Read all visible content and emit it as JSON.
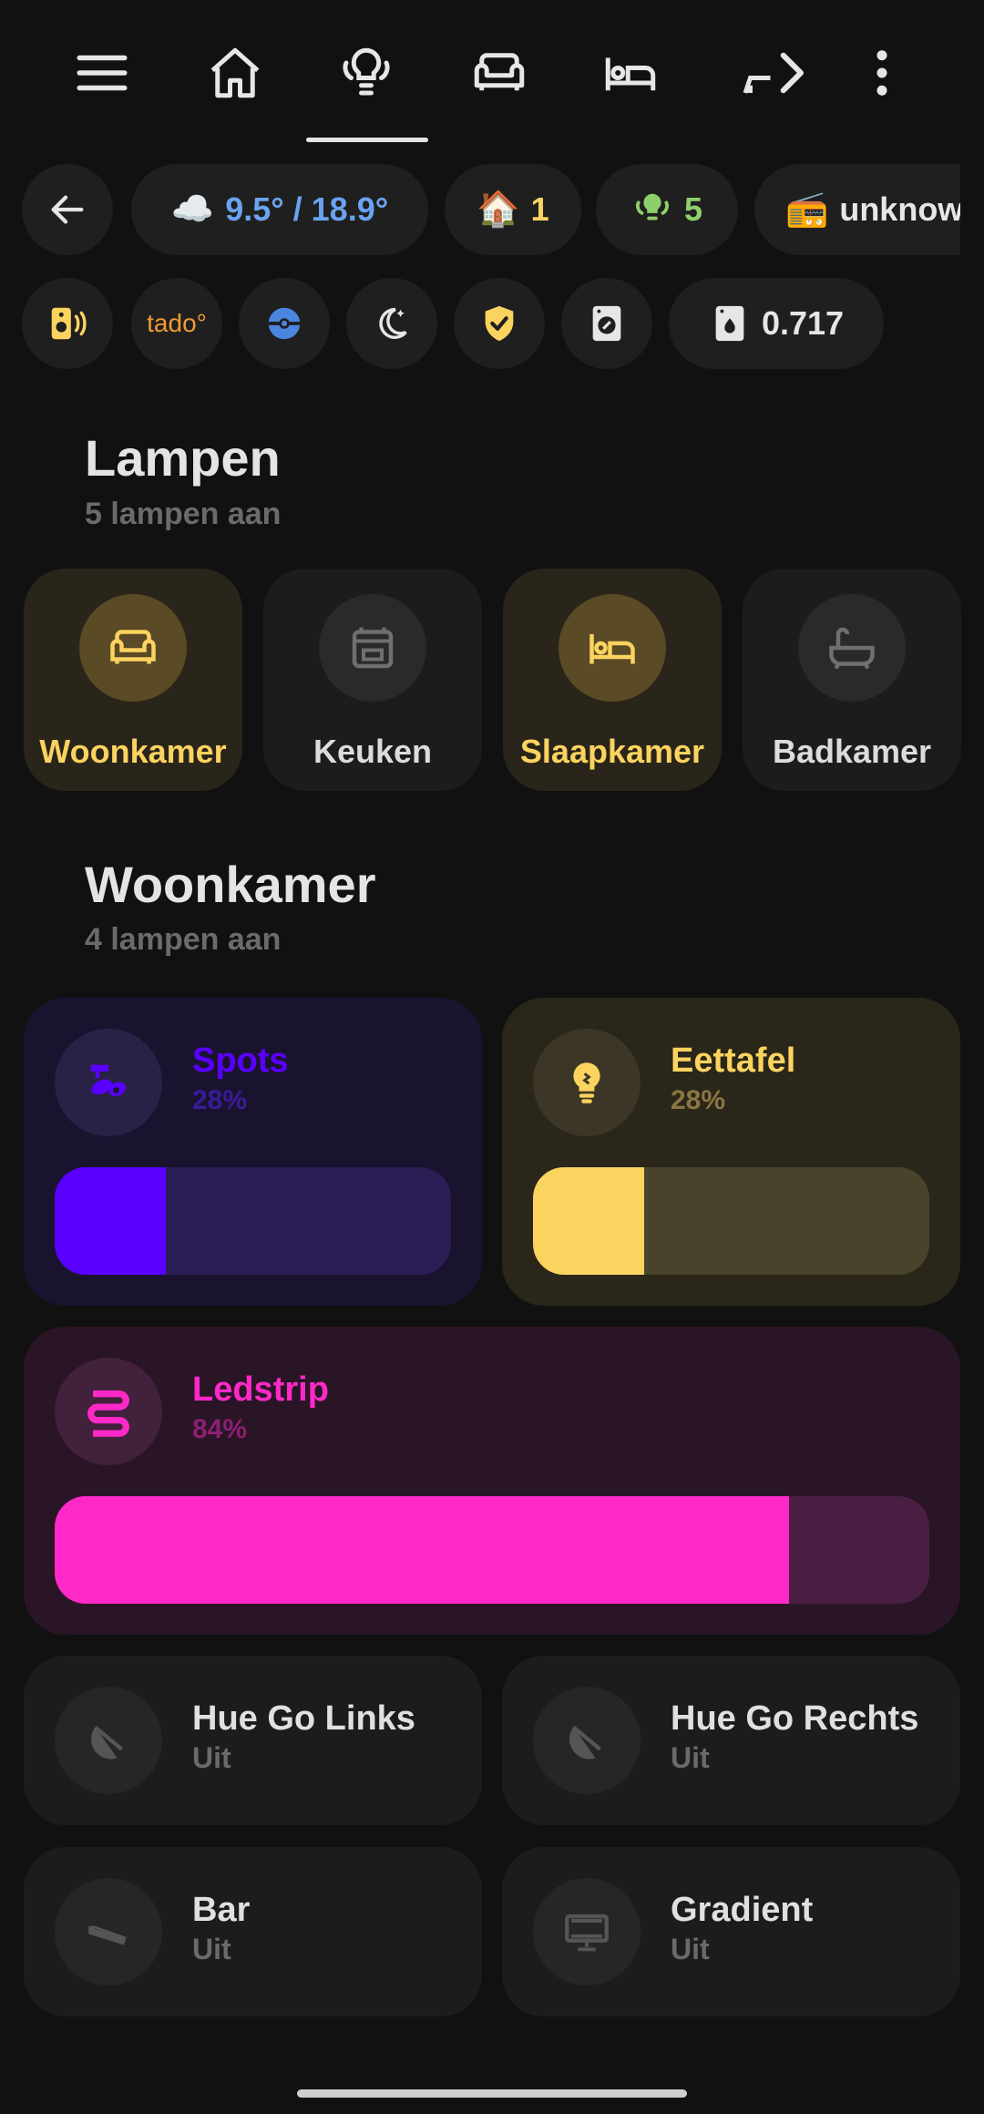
{
  "nav": {
    "tabs": [
      {
        "name": "menu",
        "icon": "menu-icon"
      },
      {
        "name": "home",
        "icon": "home-icon"
      },
      {
        "name": "lights",
        "icon": "ceiling-light-icon",
        "active": true
      },
      {
        "name": "living-room",
        "icon": "sofa-icon"
      },
      {
        "name": "bedroom",
        "icon": "bed-icon"
      },
      {
        "name": "more",
        "icon": "chevron-right-icon"
      },
      {
        "name": "overflow",
        "icon": "dots-vertical-icon"
      }
    ]
  },
  "chips": {
    "weather": {
      "icon": "☁️",
      "text": "9.5° / 18.9°",
      "color": "#6aa3f0"
    },
    "home": {
      "icon": "🏠",
      "text": "1",
      "color": "#fbd35f"
    },
    "lights": {
      "text": "5",
      "color": "#8fcf6b"
    },
    "radio": {
      "icon": "📻",
      "text": "unknow"
    },
    "tado": {
      "text": "tado°",
      "color": "#f29a32"
    },
    "washer_value": {
      "text": "0.717"
    }
  },
  "lampen": {
    "title": "Lampen",
    "subtitle": "5 lampen aan"
  },
  "rooms": [
    {
      "label": "Woonkamer",
      "on": true
    },
    {
      "label": "Keuken",
      "on": false
    },
    {
      "label": "Slaapkamer",
      "on": true
    },
    {
      "label": "Badkamer",
      "on": false
    }
  ],
  "woonkamer": {
    "title": "Woonkamer",
    "subtitle": "4 lampen aan"
  },
  "lights_on": [
    {
      "name": "Spots",
      "pct": "28%",
      "level": 0.28,
      "color": "#5a00ff"
    },
    {
      "name": "Eettafel",
      "pct": "28%",
      "level": 0.28,
      "color": "#fbd35f"
    },
    {
      "name": "Ledstrip",
      "pct": "84%",
      "level": 0.84,
      "color": "#ff29c8"
    }
  ],
  "lights_off": [
    {
      "name": "Hue Go Links",
      "state": "Uit"
    },
    {
      "name": "Hue Go Rechts",
      "state": "Uit"
    },
    {
      "name": "Bar",
      "state": "Uit"
    },
    {
      "name": "Gradient",
      "state": "Uit"
    }
  ]
}
